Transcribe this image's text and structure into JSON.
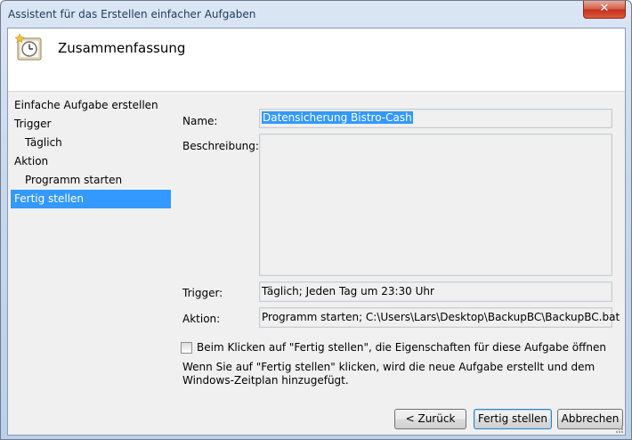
{
  "window": {
    "title": "Assistent für das Erstellen einfacher Aufgaben",
    "close_label": "✕"
  },
  "header": {
    "title": "Zusammenfassung"
  },
  "nav": {
    "items": [
      {
        "label": "Einfache Aufgabe erstellen"
      },
      {
        "label": "Trigger"
      },
      {
        "label": "Täglich"
      },
      {
        "label": "Aktion"
      },
      {
        "label": "Programm starten"
      },
      {
        "label": "Fertig stellen"
      }
    ]
  },
  "form": {
    "name_label": "Name:",
    "name_value": "Datensicherung Bistro-Cash",
    "description_label": "Beschreibung:",
    "description_value": "",
    "trigger_label": "Trigger:",
    "trigger_value": "Täglich; Jeden Tag um 23:30 Uhr",
    "action_label": "Aktion:",
    "action_value": "Programm starten; C:\\Users\\Lars\\Desktop\\BackupBC\\BackupBC.bat",
    "open_properties_label": "Beim Klicken auf \"Fertig stellen\", die Eigenschaften für diese Aufgabe öffnen",
    "open_properties_checked": false,
    "info_line1": "Wenn Sie auf \"Fertig stellen\" klicken, wird die neue Aufgabe erstellt und dem",
    "info_line2": "Windows-Zeitplan hinzugefügt."
  },
  "buttons": {
    "back_label": "< Zurück",
    "finish_label": "Fertig stellen",
    "cancel_label": "Abbrechen"
  },
  "icons": {
    "header": "task-scheduler-clock-icon",
    "close": "close-icon",
    "resize": "resize-grip-icon"
  },
  "colors": {
    "selection": "#3399ff",
    "close_button": "#c3301a",
    "title_text": "#1e395b"
  }
}
